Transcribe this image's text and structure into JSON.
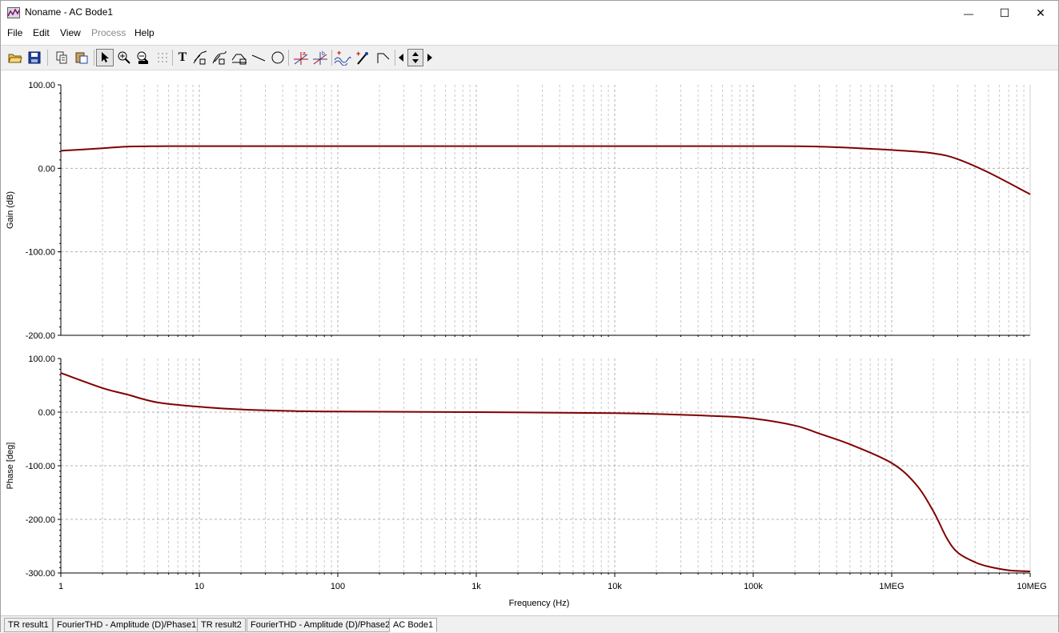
{
  "window": {
    "title": "Noname - AC Bode1",
    "controls": {
      "minimize": "—",
      "maximize": "☐",
      "close": "✕"
    }
  },
  "menu": [
    {
      "label": "File",
      "enabled": true
    },
    {
      "label": "Edit",
      "enabled": true
    },
    {
      "label": "View",
      "enabled": true
    },
    {
      "label": "Process",
      "enabled": false
    },
    {
      "label": "Help",
      "enabled": true
    }
  ],
  "toolbar": {
    "icons": [
      "open-folder-icon",
      "save-icon",
      "copy-icon",
      "paste-icon",
      "pointer-icon",
      "zoom-in-icon",
      "zoom-100-icon",
      "grid-dots-icon",
      "text-tool-icon",
      "curve-tool-1-icon",
      "curve-tool-2-icon",
      "curve-tool-3-icon",
      "line-tool-icon",
      "circle-tool-icon",
      "cursor-a-icon",
      "cursor-b-icon",
      "add-wave-icon",
      "add-marker-icon",
      "bend-icon",
      "arrow-left-icon",
      "arrow-updown-icon",
      "arrow-right-icon"
    ],
    "text_tool_label": "T"
  },
  "chart_data": [
    {
      "type": "line",
      "xscale": "log",
      "xlim": [
        1,
        10000000
      ],
      "ylim": [
        -200,
        100
      ],
      "ylabel": "Gain (dB)",
      "xlabel": "",
      "yticks": [
        "100.00",
        "0.00",
        "-100.00",
        "-200.00"
      ],
      "grid": true,
      "color": "#800000",
      "x": [
        1,
        2,
        3,
        5,
        10,
        100,
        1000,
        10000,
        100000,
        300000,
        1000000,
        2000000,
        3000000,
        5000000,
        10000000
      ],
      "values": [
        21,
        24,
        26,
        26.5,
        26.6,
        26.6,
        26.6,
        26.6,
        26.6,
        26,
        22,
        18,
        11,
        -5,
        -31
      ]
    },
    {
      "type": "line",
      "xscale": "log",
      "xlim": [
        1,
        10000000
      ],
      "ylim": [
        -300,
        100
      ],
      "ylabel": "Phase [deg]",
      "xlabel": "Frequency (Hz)",
      "xticks": [
        "1",
        "10",
        "100",
        "1k",
        "10k",
        "100k",
        "1MEG",
        "10MEG"
      ],
      "yticks": [
        "100.00",
        "0.00",
        "-100.00",
        "-200.00",
        "-300.00"
      ],
      "grid": true,
      "color": "#800000",
      "x": [
        1,
        2,
        3,
        5,
        10,
        20,
        50,
        100,
        1000,
        10000,
        50000,
        100000,
        200000,
        300000,
        500000,
        1000000,
        1500000,
        2000000,
        2500000,
        3000000,
        4000000,
        5000000,
        7000000,
        10000000
      ],
      "values": [
        73,
        45,
        33,
        18,
        10,
        5,
        2,
        1,
        0,
        -2,
        -7,
        -12,
        -25,
        -40,
        -60,
        -95,
        -135,
        -185,
        -235,
        -262,
        -280,
        -288,
        -295,
        -297
      ]
    }
  ],
  "tabs": [
    {
      "label": "TR result1",
      "active": false
    },
    {
      "label": "FourierTHD - Amplitude (D)/Phase1",
      "active": false
    },
    {
      "label": "TR result2",
      "active": false
    },
    {
      "label": "FourierTHD - Amplitude (D)/Phase2",
      "active": false
    },
    {
      "label": "AC Bode1",
      "active": true
    }
  ]
}
